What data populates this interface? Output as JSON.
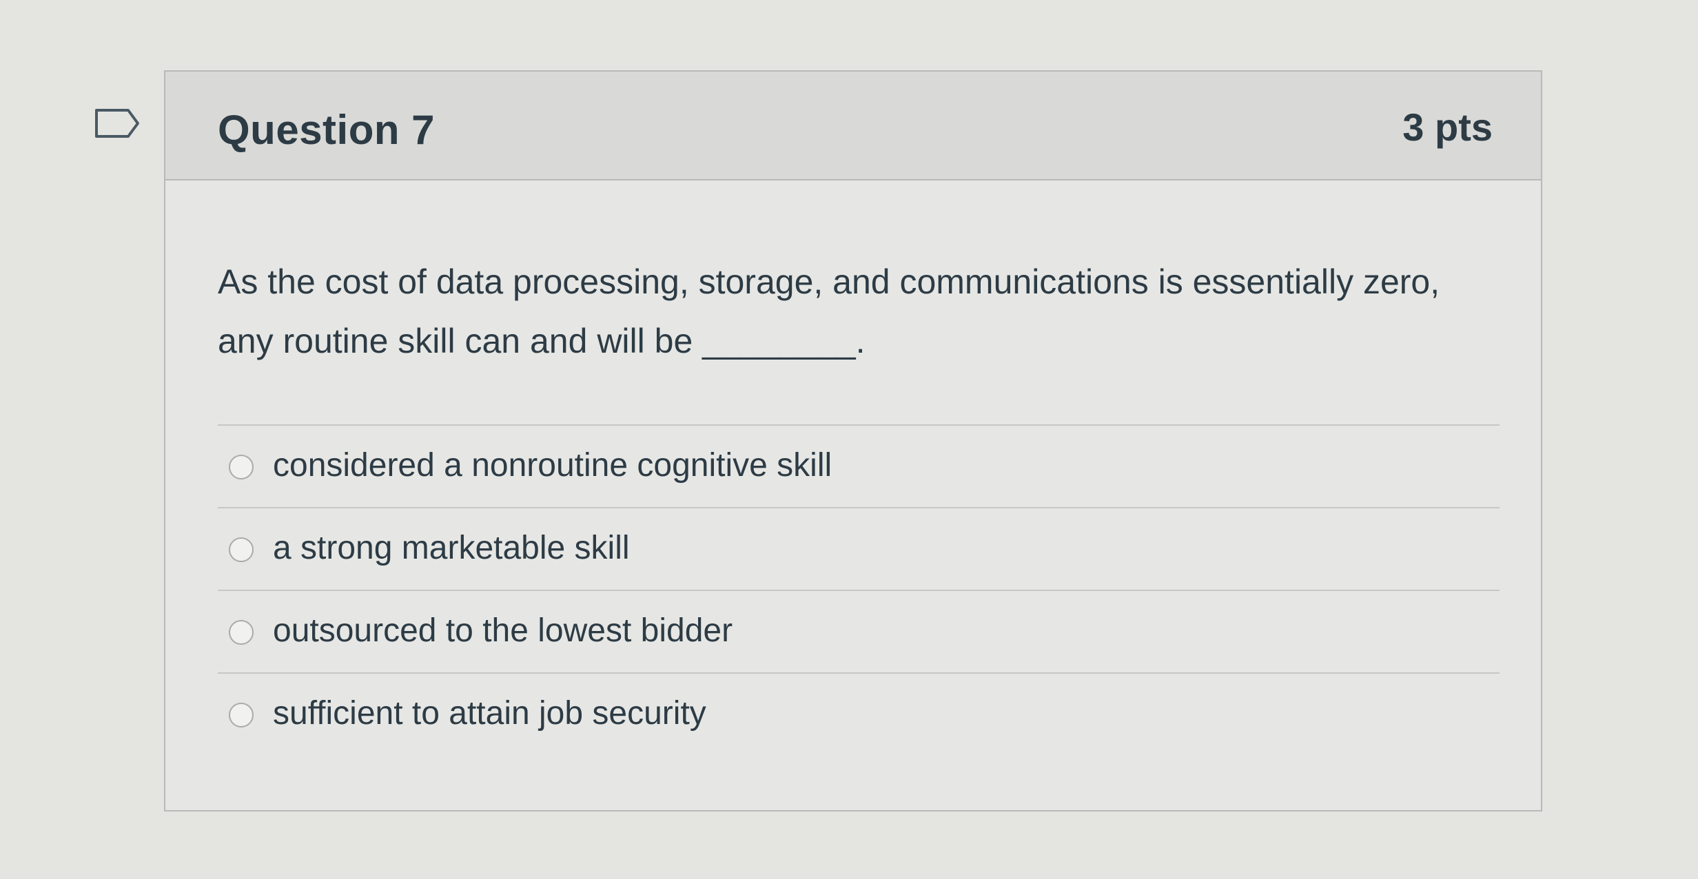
{
  "question": {
    "title": "Question 7",
    "points": "3 pts",
    "text": "As the cost of data processing, storage, and communications is essentially zero, any routine skill can and will be ________.",
    "flag_icon": "bookmark-flag-icon"
  },
  "answers": [
    {
      "label": "considered a nonroutine cognitive skill",
      "selected": false
    },
    {
      "label": "a strong marketable skill",
      "selected": false
    },
    {
      "label": "outsourced to the lowest bidder",
      "selected": false
    },
    {
      "label": "sufficient to attain job security",
      "selected": false
    }
  ],
  "colors": {
    "background": "#e4e4e1",
    "header": "#d9dad7",
    "text": "#2d3b45",
    "border": "#b8bab8"
  }
}
